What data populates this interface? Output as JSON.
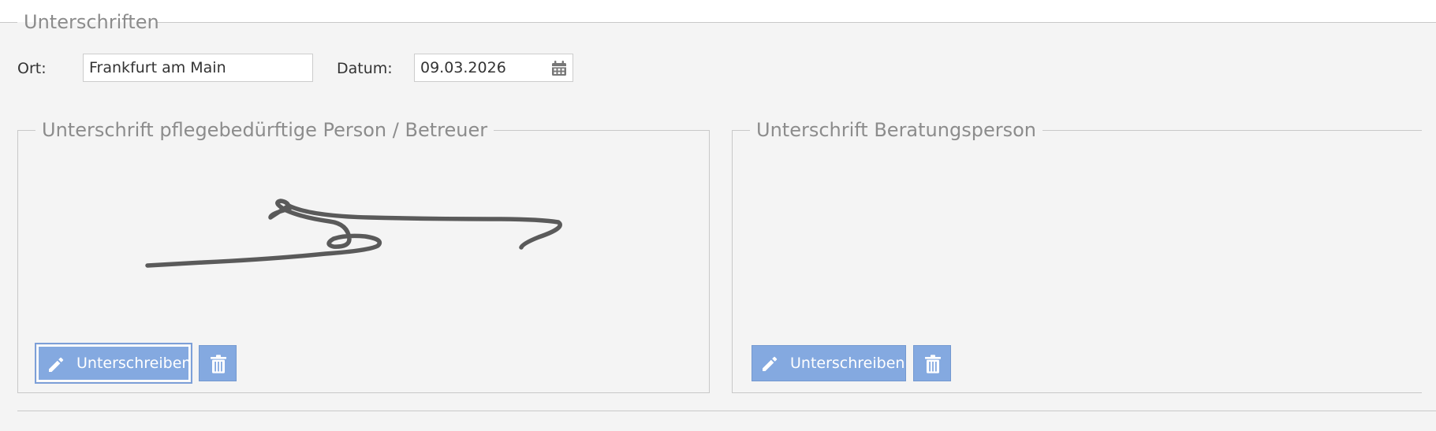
{
  "section": {
    "title": "Unterschriften"
  },
  "form": {
    "ort_label": "Ort:",
    "ort_value": "Frankfurt am Main",
    "datum_label": "Datum:",
    "datum_value": "09.03.2026"
  },
  "panels": [
    {
      "title": "Unterschrift pflegebedürftige Person / Betreuer",
      "sign_label": "Unterschreiben",
      "has_signature": true
    },
    {
      "title": "Unterschrift Beratungsperson",
      "sign_label": "Unterschreiben",
      "has_signature": false
    }
  ],
  "icons": {
    "calendar": "calendar-icon",
    "pencil": "pencil-icon",
    "trash": "trash-icon"
  },
  "colors": {
    "button_bg": "#84a9e0",
    "legend_text": "#8c8c8c",
    "signature_stroke": "#5a5a5a"
  }
}
